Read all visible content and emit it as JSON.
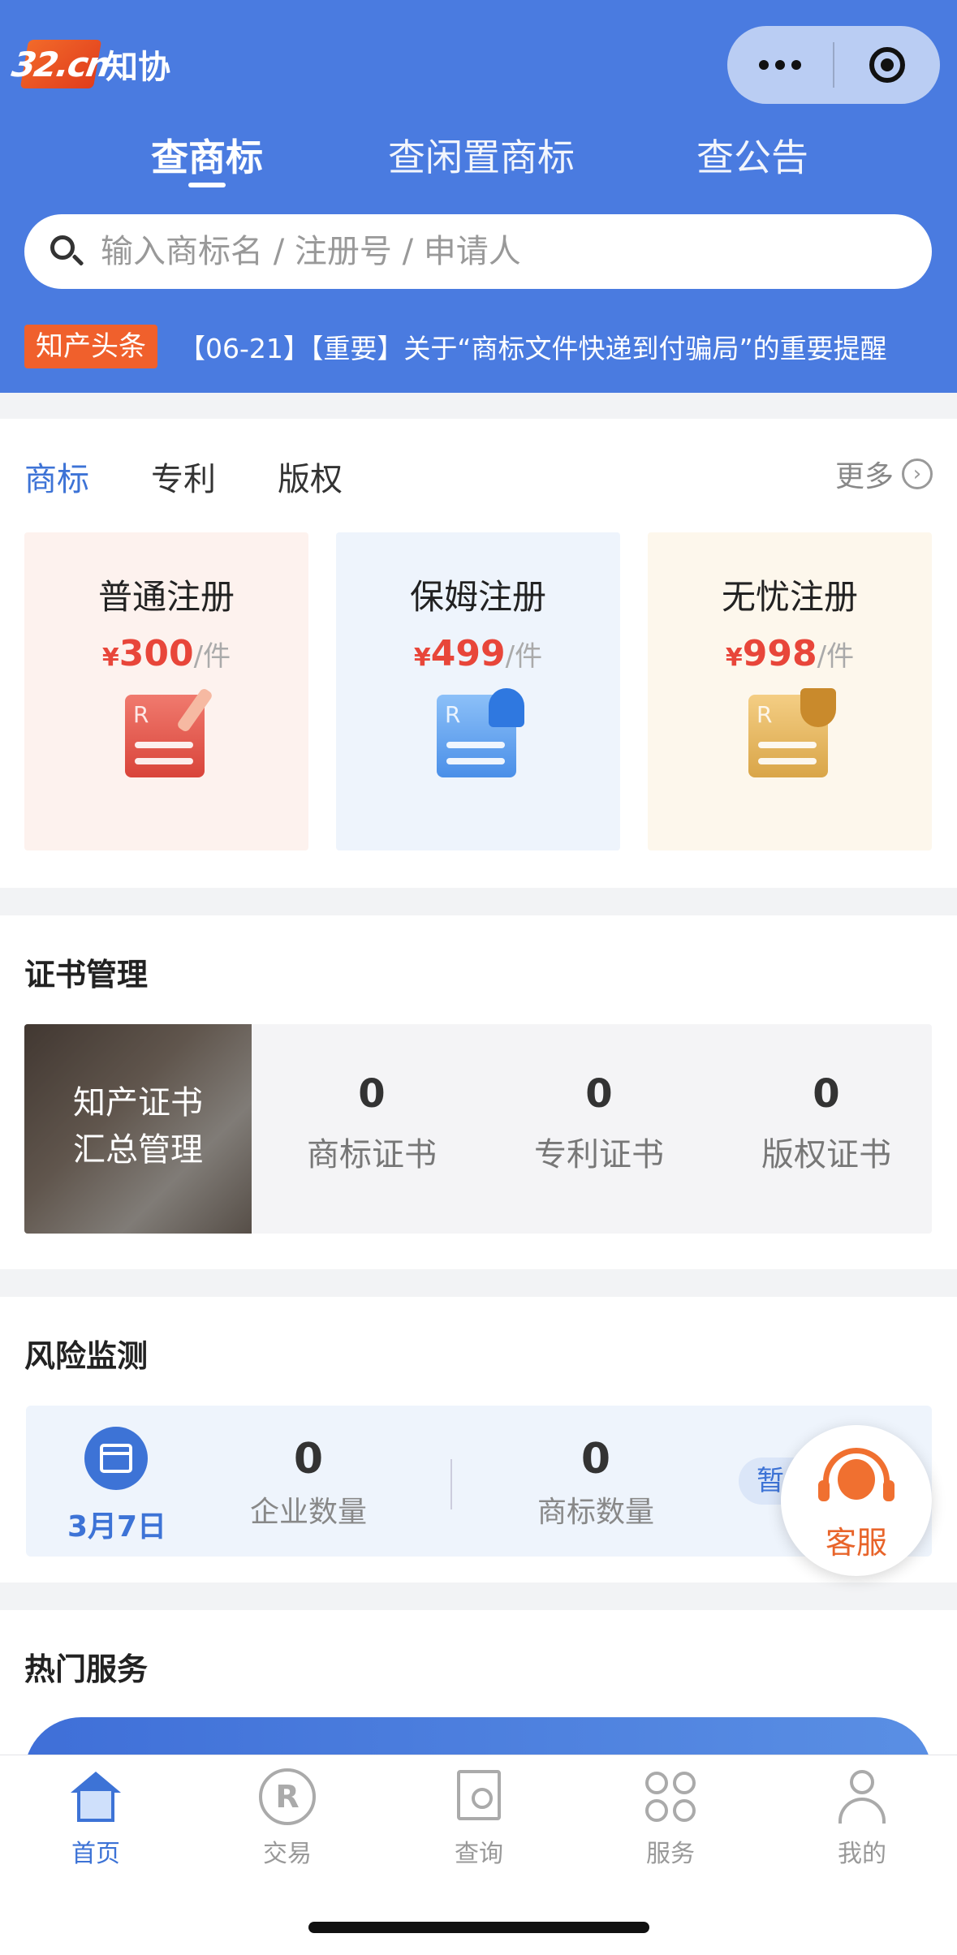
{
  "header": {
    "logo_mark": "32.cn",
    "logo_text": "知协",
    "search_tabs": [
      {
        "label": "查商标",
        "active": true
      },
      {
        "label": "查闲置商标",
        "active": false
      },
      {
        "label": "查公告",
        "active": false
      }
    ],
    "search": {
      "placeholder": "输入商标名 / 注册号 / 申请人",
      "value": ""
    },
    "news": {
      "tag": "知产头条",
      "text": "【06-21】【重要】关于“商标文件快递到付骗局”的重要提醒"
    },
    "color_bg": "#4a7be0"
  },
  "categories": {
    "tabs": [
      {
        "label": "商标",
        "active": true
      },
      {
        "label": "专利",
        "active": false
      },
      {
        "label": "版权",
        "active": false
      }
    ],
    "more_label": "更多",
    "packages": [
      {
        "name": "普通注册",
        "currency": "¥",
        "price": "300",
        "unit": "/件",
        "icon": "document-edit-icon"
      },
      {
        "name": "保姆注册",
        "currency": "¥",
        "price": "499",
        "unit": "/件",
        "icon": "document-user-icon"
      },
      {
        "name": "无忧注册",
        "currency": "¥",
        "price": "998",
        "unit": "/件",
        "icon": "document-shield-icon"
      }
    ]
  },
  "certificates": {
    "title": "证书管理",
    "image_text_line1": "知产证书",
    "image_text_line2": "汇总管理",
    "stats": [
      {
        "value": "0",
        "label": "商标证书"
      },
      {
        "value": "0",
        "label": "专利证书"
      },
      {
        "value": "0",
        "label": "版权证书"
      }
    ]
  },
  "risk": {
    "title": "风险监测",
    "date": "3月7日",
    "stats": [
      {
        "value": "0",
        "label": "企业数量"
      },
      {
        "value": "0",
        "label": "商标数量"
      }
    ],
    "chip_label": "暂"
  },
  "customer_service": {
    "label": "客服"
  },
  "hot_services": {
    "title": "热门服务"
  },
  "tabbar": [
    {
      "label": "首页",
      "icon": "home-icon",
      "active": true
    },
    {
      "label": "交易",
      "icon": "trade-icon",
      "active": false
    },
    {
      "label": "查询",
      "icon": "query-icon",
      "active": false
    },
    {
      "label": "服务",
      "icon": "services-icon",
      "active": false
    },
    {
      "label": "我的",
      "icon": "profile-icon",
      "active": false
    }
  ],
  "colors": {
    "accent": "#3d73d6",
    "price": "#e8463a",
    "news_tag": "#f0602c",
    "service": "#f07030"
  }
}
